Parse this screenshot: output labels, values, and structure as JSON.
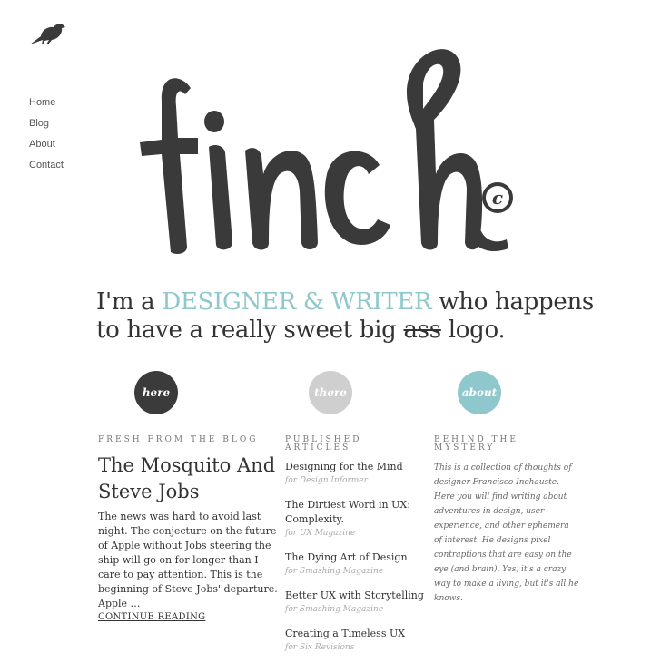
{
  "nav": {
    "items": [
      {
        "label": "Home"
      },
      {
        "label": "Blog"
      },
      {
        "label": "About"
      },
      {
        "label": "Contact"
      }
    ]
  },
  "logo": {
    "text": "finch",
    "copyright_mark": "c"
  },
  "social": [
    {
      "icon": "twitter-icon",
      "color": "#5bb3c6"
    },
    {
      "icon": "rss-icon",
      "color": "#f19a1c"
    },
    {
      "icon": "dribbble-icon",
      "color": "#e8577d"
    }
  ],
  "tagline": {
    "part1": "I'm a ",
    "accent": "DESIGNER & WRITER",
    "part2": " who happens to have a really sweet big ",
    "strike": "ass",
    "part3": " logo."
  },
  "badges": {
    "here": "here",
    "there": "there",
    "about": "about"
  },
  "blog": {
    "heading": "FRESH FROM THE BLOG",
    "title": "The Mosquito And Steve Jobs",
    "excerpt": "The news was hard to avoid last night. The conjecture on the future of Apple without Jobs steering the ship will go on for longer than I care to pay attention. This is the beginning of Steve Jobs' departure. Apple …",
    "continue": "CONTINUE READING"
  },
  "articles": {
    "heading": "PUBLISHED ARTICLES",
    "items": [
      {
        "title": "Designing for the Mind",
        "source": "for Design Informer"
      },
      {
        "title": "The Dirtiest Word in UX: Complexity.",
        "source": "for UX Magazine"
      },
      {
        "title": "The Dying Art of Design",
        "source": "for Smashing Magazine"
      },
      {
        "title": "Better UX with Storytelling",
        "source": "for Smashing Magazine"
      },
      {
        "title": "Creating a Timeless UX",
        "source": "for Six Revisions"
      }
    ]
  },
  "about": {
    "heading": "BEHIND THE MYSTERY",
    "text": "This is a collection of thoughts of designer Francisco Inchauste. Here you will find writing about adventures in design, user experience, and other ephemera of interest. He designs pixel contraptions that are easy on the eye (and brain). Yes, it's a crazy way to make a living, but it's all he knows."
  }
}
